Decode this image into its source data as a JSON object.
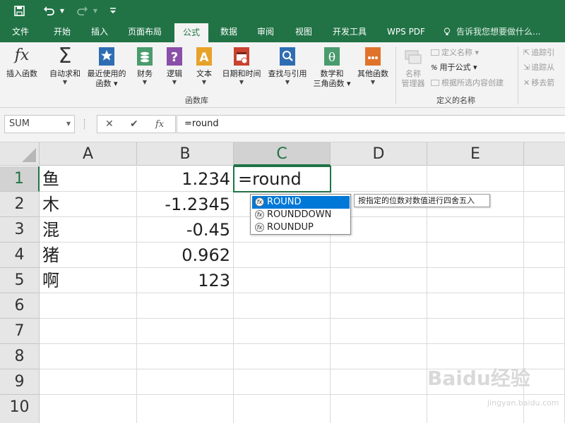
{
  "quick_access": {
    "save": "save-icon",
    "undo": "undo-icon",
    "redo": "redo-icon",
    "customize": "customize-qat-icon"
  },
  "tabs": [
    "文件",
    "开始",
    "插入",
    "页面布局",
    "公式",
    "数据",
    "审阅",
    "视图",
    "开发工具",
    "WPS PDF"
  ],
  "active_tab": "公式",
  "tell_me": "告诉我您想要做什么...",
  "ribbon": {
    "insert_function": "插入函数",
    "autosum": "自动求和",
    "recent_line1": "最近使用的",
    "recent_line2": "函数",
    "financial": "财务",
    "logical": "逻辑",
    "text": "文本",
    "datetime": "日期和时间",
    "lookup": "查找与引用",
    "math_line1": "数学和",
    "math_line2": "三角函数",
    "other": "其他函数",
    "library_label": "函数库",
    "name_manager_line1": "名称",
    "name_manager_line2": "管理器",
    "define_name": "定义名称",
    "use_in_formula": "用于公式",
    "create_from_selection": "根据所选内容创建",
    "defined_names_label": "定义的名称",
    "trace_precedents": "追踪引",
    "trace_dependents": "追踪从",
    "remove_arrows": "移去箭"
  },
  "name_box": "SUM",
  "formula": "=round",
  "columns": [
    "A",
    "B",
    "C",
    "D",
    "E"
  ],
  "rows": [
    "1",
    "2",
    "3",
    "4",
    "5",
    "6",
    "7",
    "8",
    "9",
    "10"
  ],
  "cells": {
    "a1": "鱼",
    "b1": "1.234",
    "c1": "=round",
    "a2": "木",
    "b2": "-1.2345",
    "a3": "混",
    "b3": "-0.45",
    "a4": "猪",
    "b4": "0.962",
    "a5": "啊",
    "b5": "123"
  },
  "autocomplete": [
    "ROUND",
    "ROUNDDOWN",
    "ROUNDUP"
  ],
  "autocomplete_selected": "ROUND",
  "tooltip": "按指定的位数对数值进行四舍五入",
  "watermark": "Baidu经验",
  "watermark_url": "jingyan.baidu.com",
  "colors": {
    "excel_green": "#217346",
    "selection_blue": "#0078d7"
  }
}
